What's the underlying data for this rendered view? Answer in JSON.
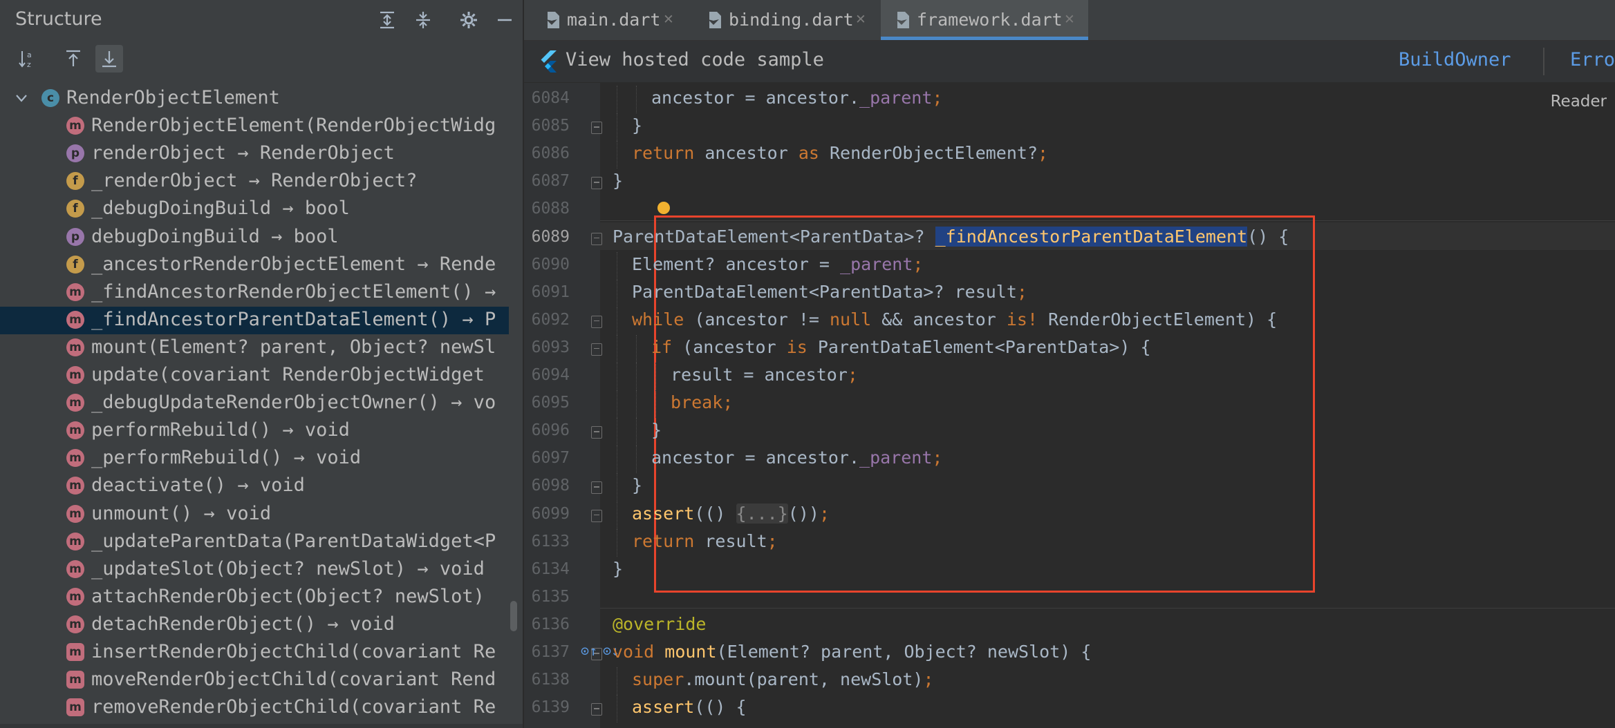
{
  "structure": {
    "title": "Structure",
    "tree": [
      {
        "kind": "c",
        "label": "RenderObjectElement",
        "indent": 0,
        "arrow": true
      },
      {
        "kind": "m",
        "label": "RenderObjectElement(RenderObjectWidg"
      },
      {
        "kind": "p",
        "label": "renderObject → RenderObject"
      },
      {
        "kind": "f",
        "label": "_renderObject → RenderObject?"
      },
      {
        "kind": "f",
        "label": "_debugDoingBuild → bool"
      },
      {
        "kind": "p",
        "label": "debugDoingBuild → bool"
      },
      {
        "kind": "f",
        "label": "_ancestorRenderObjectElement → Rende"
      },
      {
        "kind": "m",
        "label": "_findAncestorRenderObjectElement() →"
      },
      {
        "kind": "m",
        "label": "_findAncestorParentDataElement() → P",
        "selected": true
      },
      {
        "kind": "m",
        "label": "mount(Element? parent, Object? newSl"
      },
      {
        "kind": "m",
        "label": "update(covariant RenderObjectWidget"
      },
      {
        "kind": "m",
        "label": "_debugUpdateRenderObjectOwner() → vo"
      },
      {
        "kind": "m",
        "label": "performRebuild() → void"
      },
      {
        "kind": "m",
        "label": "_performRebuild() → void"
      },
      {
        "kind": "m",
        "label": "deactivate() → void"
      },
      {
        "kind": "m",
        "label": "unmount() → void"
      },
      {
        "kind": "m",
        "label": "_updateParentData(ParentDataWidget<P"
      },
      {
        "kind": "m",
        "label": "_updateSlot(Object? newSlot) → void"
      },
      {
        "kind": "m",
        "label": "attachRenderObject(Object? newSlot)"
      },
      {
        "kind": "m",
        "label": "detachRenderObject() → void"
      },
      {
        "kind": "ma",
        "label": "insertRenderObjectChild(covariant Re"
      },
      {
        "kind": "ma",
        "label": "moveRenderObjectChild(covariant Rend"
      },
      {
        "kind": "ma",
        "label": "removeRenderObjectChild(covariant Re"
      }
    ]
  },
  "tabs": [
    {
      "label": "main.dart"
    },
    {
      "label": "binding.dart"
    },
    {
      "label": "framework.dart",
      "active": true
    }
  ],
  "banner": {
    "text": "View hosted code sample",
    "link1": "BuildOwner",
    "link2": "Erro"
  },
  "reader": "Reader",
  "lines": [
    "6084",
    "6085",
    "6086",
    "6087",
    "6088",
    "6089",
    "6090",
    "6091",
    "6092",
    "6093",
    "6094",
    "6095",
    "6096",
    "6097",
    "6098",
    "6099",
    "6133",
    "6134",
    "6135",
    "6136",
    "6137",
    "6138",
    "6139"
  ],
  "colors": {
    "accent": "#4a88c7",
    "highlight_box": "#e8442c",
    "selection": "#214283"
  }
}
